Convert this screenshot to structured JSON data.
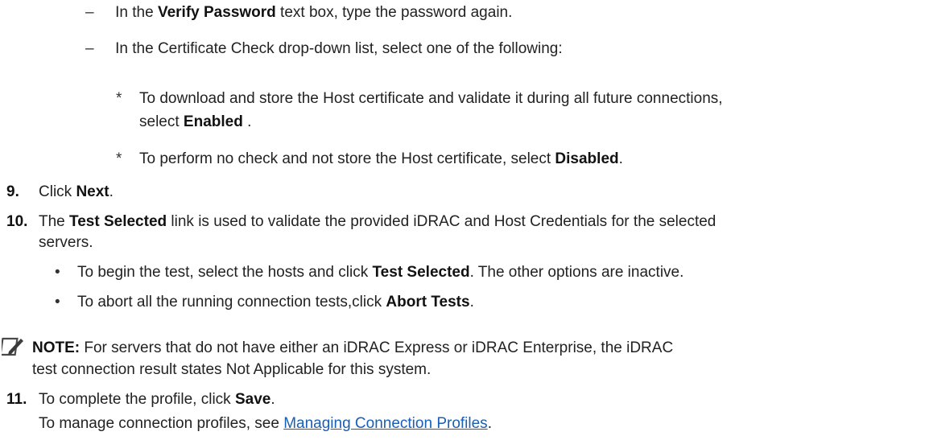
{
  "sub_items": [
    {
      "mark": "–",
      "pre": "In the ",
      "bold": "Verify Password",
      "post": " text box, type the password again."
    },
    {
      "mark": "–",
      "text": "In the Certificate Check drop-down list, select one of the following:"
    }
  ],
  "star_items": [
    {
      "mark": "*",
      "line1": "To download and store the Host certificate and validate it during all future connections,",
      "line2_pre": "select ",
      "line2_bold": "Enabled",
      "line2_post": " ."
    },
    {
      "mark": "*",
      "pre": "To perform no check and not store the Host certificate, select ",
      "bold": "Disabled",
      "post": "."
    }
  ],
  "step9": {
    "num": "9.",
    "pre": "Click ",
    "bold": "Next",
    "post": "."
  },
  "step10": {
    "num": "10.",
    "pre": "The ",
    "bold": "Test Selected",
    "post": " link is used to validate the provided iDRAC and Host Credentials for the selected",
    "line2": "servers."
  },
  "bullets": [
    {
      "mark": "•",
      "pre": "To begin the test, select the hosts and click ",
      "bold": "Test Selected",
      "post": ". The other options are inactive."
    },
    {
      "mark": "•",
      "pre": "To abort all the running connection tests,click ",
      "bold": "Abort Tests",
      "post": "."
    }
  ],
  "note": {
    "label": "NOTE:",
    "line1": " For servers that do not have either an iDRAC Express or iDRAC Enterprise, the iDRAC",
    "line2": "test connection result states Not Applicable for this system."
  },
  "step11": {
    "num": "11.",
    "pre": "To complete the profile, click ",
    "bold": "Save",
    "post": ".",
    "line2_pre": "To manage connection profiles, see ",
    "line2_link": "Managing Connection Profiles",
    "line2_post": "."
  }
}
